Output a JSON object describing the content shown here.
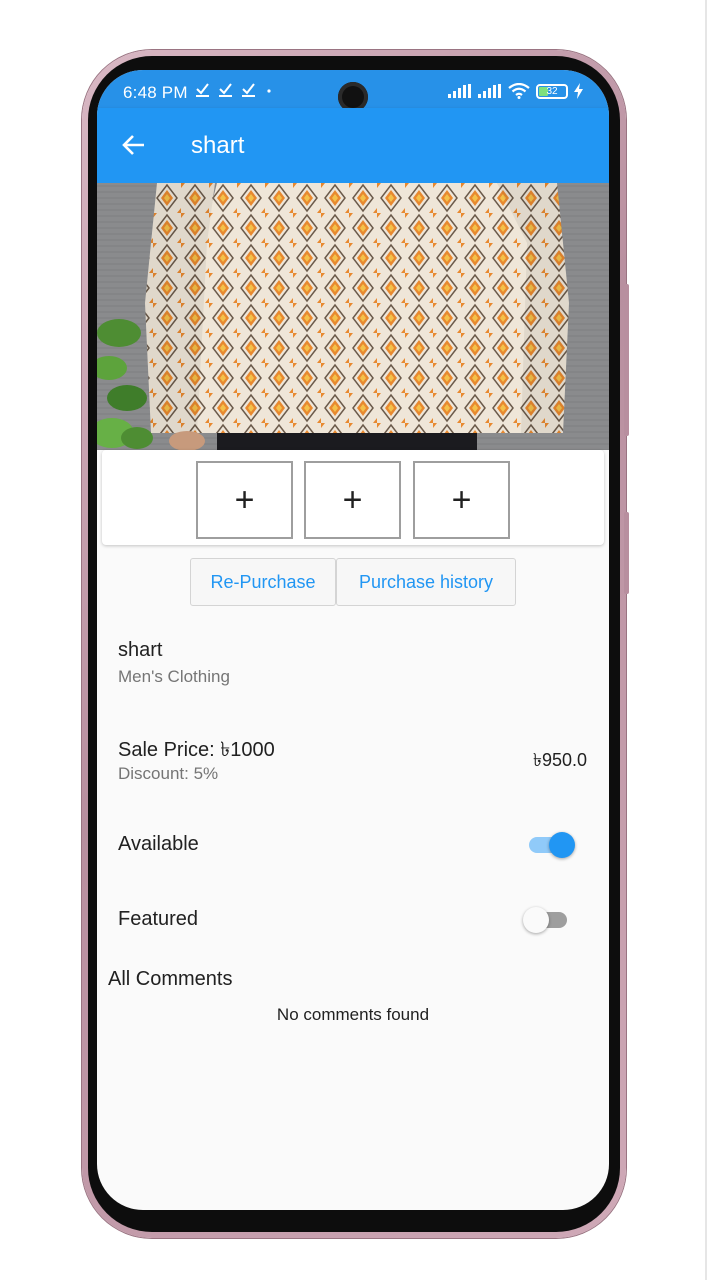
{
  "status_bar": {
    "time": "6:48 PM",
    "notification_icons": [
      "download-done-icon",
      "download-done-icon",
      "download-done-icon",
      "dot-icon"
    ],
    "battery": "32",
    "signal_icons": [
      "signal-icon",
      "signal-icon",
      "wifi-icon",
      "battery-icon",
      "charging-icon"
    ]
  },
  "app_bar": {
    "title": "shart",
    "back_icon": "arrow-back-icon"
  },
  "image_slots": [
    "+",
    "+",
    "+"
  ],
  "buttons": {
    "repurchase": "Re-Purchase",
    "history": "Purchase history"
  },
  "product": {
    "name": "shart",
    "category": "Men's Clothing",
    "sale_price": "Sale Price: ৳1000",
    "discount": "Discount: 5%",
    "final_price": "৳950.0"
  },
  "toggles": {
    "available": {
      "label": "Available",
      "value": true
    },
    "featured": {
      "label": "Featured",
      "value": false
    }
  },
  "comments": {
    "title": "All Comments",
    "empty": "No comments found"
  },
  "colors": {
    "primary": "#2196f3",
    "status_bar": "#2791e8",
    "background": "#fafafa",
    "phone_frame": "#c9a3b2"
  }
}
